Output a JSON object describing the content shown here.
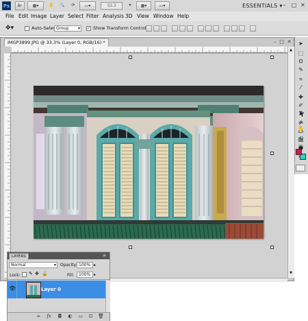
{
  "app": {
    "logo": "Ps",
    "zoom": "33.3",
    "workspace": "ESSENTIALS",
    "window_controls": [
      "–",
      "□",
      "✕"
    ]
  },
  "menu": [
    "File",
    "Edit",
    "Image",
    "Layer",
    "Select",
    "Filter",
    "Analysis",
    "3D",
    "View",
    "Window",
    "Help"
  ],
  "options": {
    "auto_select_label": "Auto-Select:",
    "auto_select_value": "Group",
    "show_transform_label": "Show Transform Controls",
    "show_transform_checked": true,
    "auto_select_checked": false
  },
  "document": {
    "tab_title": "IMGP3899.JPG @ 33.3% (Layer 0, RGB/16) *"
  },
  "colors": {
    "foreground": "#d8154a",
    "background": "#2ad4c8",
    "selection_blue": "#3b8de6"
  },
  "tools": [
    "move-tool",
    "marquee-tool",
    "lasso-tool",
    "quick-select-tool",
    "crop-tool",
    "eyedropper-tool",
    "healing-tool",
    "brush-tool",
    "clone-stamp-tool",
    "history-brush-tool",
    "eraser-tool",
    "gradient-tool",
    "dodge-tool",
    "pen-tool",
    "type-tool",
    "path-select-tool",
    "shape-tool",
    "3d-rotate-tool",
    "3d-orbit-tool",
    "hand-tool",
    "zoom-tool"
  ],
  "layers_panel": {
    "tab": "LAYERS",
    "blend_mode": "Normal",
    "opacity_label": "Opacity:",
    "opacity_value": "100%",
    "lock_label": "Lock:",
    "fill_label": "Fill:",
    "fill_value": "100%",
    "layer_name": "Layer 0",
    "footer_icons": [
      "link-icon",
      "fx-icon",
      "mask-icon",
      "adjustment-icon",
      "group-icon",
      "new-layer-icon",
      "trash-icon"
    ]
  }
}
